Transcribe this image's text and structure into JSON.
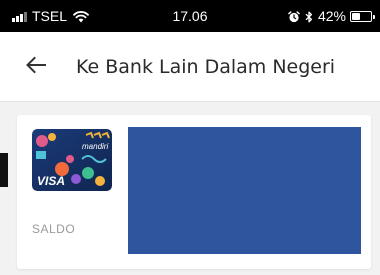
{
  "status_bar": {
    "carrier": "TSEL",
    "time": "17.06",
    "battery_percent": "42%",
    "battery_level": 0.42,
    "icons": [
      "signal-icon",
      "wifi-icon",
      "alarm-icon",
      "bluetooth-icon",
      "battery-icon"
    ]
  },
  "header": {
    "title": "Ke Bank Lain Dalam Negeri",
    "back_icon": "arrow-left-icon"
  },
  "account_card": {
    "balance_label": "SALDO",
    "card_brand": "mandiri",
    "card_network": "VISA",
    "account_block_color": "#2f559e"
  },
  "colors": {
    "status_bar_bg": "#000000",
    "header_bg": "#ffffff",
    "page_bg": "#f2f2f2",
    "masked_block": "#2f559e"
  }
}
